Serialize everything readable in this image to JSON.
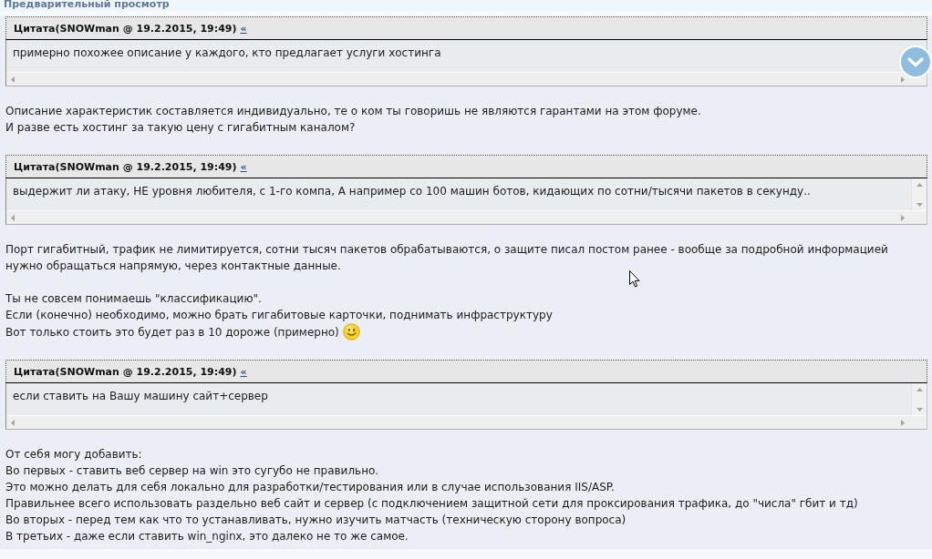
{
  "preview": {
    "title": "Предварительный просмотр"
  },
  "content": [
    {
      "kind": "quote",
      "header": "Цитата(SNOWman @ 19.2.2015, 19:49)",
      "link": "«",
      "text": "примерно похожее описание у каждого, кто предлагает услуги хостинга"
    },
    {
      "kind": "text",
      "lines": [
        {
          "text": "Описание характеристик составляется индивидуально, те о ком ты говоришь не являются гарантами на этом форуме.",
          "emoticon": false
        },
        {
          "text": "И разве есть хостинг за такую цену с гигабитным каналом?",
          "emoticon": false
        }
      ]
    },
    {
      "kind": "quote",
      "header": "Цитата(SNOWman @ 19.2.2015, 19:49)",
      "link": "«",
      "text": "выдержит ли атаку, НЕ уровня любителя, с 1-го компа, А например со 100 машин ботов, кидающих по сотни/тысячи пакетов в секунду.."
    },
    {
      "kind": "text",
      "lines": [
        {
          "text": "Порт гигабитный, трафик не лимитируется, сотни тысяч пакетов обрабатываются, о защите писал постом ранее - вообще за подробной информацией нужно обращаться напрямую, через контактные данные.",
          "emoticon": false
        }
      ]
    },
    {
      "kind": "text",
      "lines": [
        {
          "text": "Ты не совсем понимаешь \"классификацию\".",
          "emoticon": false
        },
        {
          "text": "Если (конечно) необходимо, можно брать гигабитовые карточки, поднимать инфраструктуру",
          "emoticon": false
        },
        {
          "text": "Вот только стоить это будет раз в 10 дороже (примерно)",
          "emoticon": true
        }
      ]
    },
    {
      "kind": "quote",
      "header": "Цитата(SNOWman @ 19.2.2015, 19:49)",
      "link": "«",
      "text": "если ставить на Вашу машину сайт+сервер"
    },
    {
      "kind": "text",
      "lines": [
        {
          "text": "От себя могу добавить:",
          "emoticon": false
        },
        {
          "text": "Во первых - ставить веб сервер на win это сугубо не правильно.",
          "emoticon": false
        },
        {
          "text": "Это можно делать для себя локально для разработки/тестирования или в случае использования IIS/ASP.",
          "emoticon": false
        },
        {
          "text": "Правильнее всего использовать раздельно веб сайт и сервер (с подключением защитной сети для проксирования трафика, до \"числа\" гбит и тд)",
          "emoticon": false
        },
        {
          "text": "Во вторых - перед тем как что то устанавливать, нужно изучить матчасть (техническую сторону вопроса)",
          "emoticon": false
        },
        {
          "text": "В третьих - даже если ставить win_nginx, это далеко не то же самое.",
          "emoticon": false
        }
      ]
    }
  ]
}
